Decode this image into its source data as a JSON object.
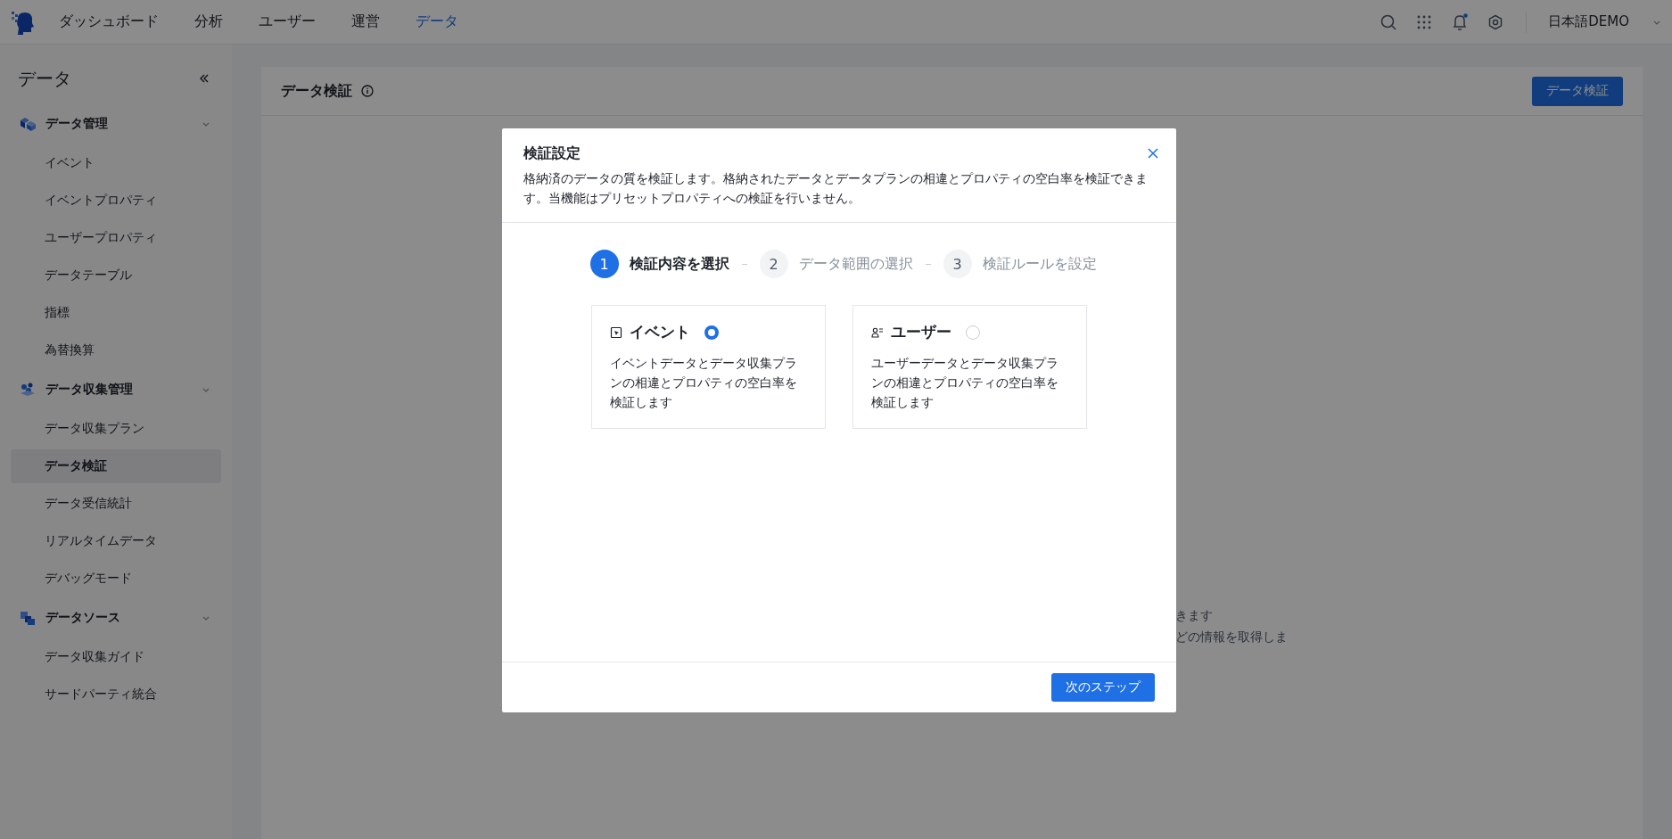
{
  "top_nav": {
    "items": [
      {
        "label": "ダッシュボード",
        "selected": false
      },
      {
        "label": "分析",
        "selected": false
      },
      {
        "label": "ユーザー",
        "selected": false
      },
      {
        "label": "運営",
        "selected": false
      },
      {
        "label": "データ",
        "selected": true
      }
    ],
    "account": "日本語DEMO"
  },
  "sidebar": {
    "title": "データ",
    "groups": [
      {
        "kind": "cubes",
        "label": "データ管理",
        "expanded": true,
        "items": [
          {
            "label": "イベント",
            "selected": false
          },
          {
            "label": "イベントプロパティ",
            "selected": false
          },
          {
            "label": "ユーザープロパティ",
            "selected": false
          },
          {
            "label": "データテーブル",
            "selected": false
          },
          {
            "label": "指標",
            "selected": false
          },
          {
            "label": "為替換算",
            "selected": false
          }
        ]
      },
      {
        "kind": "dots",
        "label": "データ収集管理",
        "expanded": true,
        "items": [
          {
            "label": "データ収集プラン",
            "selected": false
          },
          {
            "label": "データ検証",
            "selected": true
          },
          {
            "label": "データ受信統計",
            "selected": false
          },
          {
            "label": "リアルタイムデータ",
            "selected": false
          },
          {
            "label": "デバッグモード",
            "selected": false
          }
        ]
      },
      {
        "kind": "squares",
        "label": "データソース",
        "expanded": true,
        "items": [
          {
            "label": "データ収集ガイド",
            "selected": false
          },
          {
            "label": "サードパーティ統合",
            "selected": false
          }
        ]
      }
    ]
  },
  "page": {
    "title": "データ検証",
    "action_button": "データ検証",
    "notice_lines": [
      "きます",
      "どの情報を取得しま"
    ]
  },
  "modal": {
    "title": "検証設定",
    "description": "格納済のデータの質を検証します。格納されたデータとデータプランの相違とプロパティの空白率を検証できます。当機能はプリセットプロパティへの検証を行いません。",
    "steps": [
      {
        "number": "1",
        "label": "検証内容を選択",
        "selected": true
      },
      {
        "number": "2",
        "label": "データ範囲の選択",
        "selected": false
      },
      {
        "number": "3",
        "label": "検証ルールを設定",
        "selected": false
      }
    ],
    "options": [
      {
        "kind": "event",
        "title": "イベント",
        "selected": true,
        "description": "イベントデータとデータ収集プランの相違とプロパティの空白率を検証します"
      },
      {
        "kind": "user",
        "title": "ユーザー",
        "selected": false,
        "description": "ユーザーデータとデータ収集プランの相違とプロパティの空白率を検証します"
      }
    ],
    "next_button": "次のステップ"
  }
}
